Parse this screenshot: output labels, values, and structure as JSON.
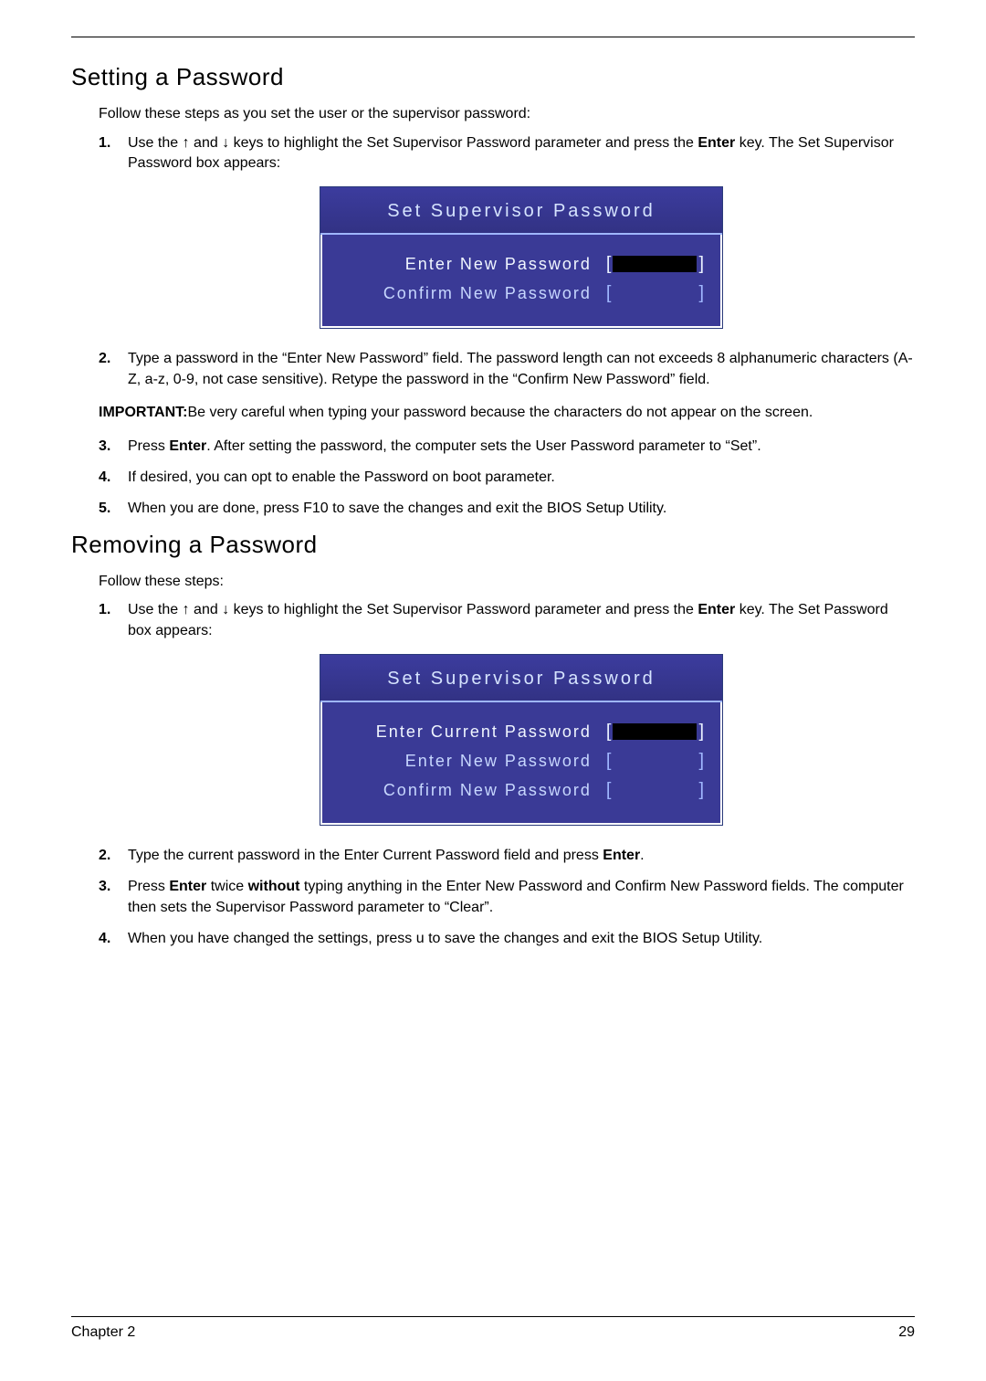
{
  "sections": {
    "setting": {
      "heading": "Setting a Password",
      "intro": "Follow these steps as you set the user or the supervisor password:",
      "steps": {
        "s1_pre": "Use the ",
        "s1_up": "↑",
        "s1_mid": " and ",
        "s1_down": "↓",
        "s1_post1": " keys to highlight the Set Supervisor Password parameter and press the ",
        "s1_enter": "Enter",
        "s1_post2": " key. The Set Supervisor Password box appears:",
        "s2": "Type a password in the “Enter New Password” field. The password length can not exceeds 8 alphanumeric characters (A-Z, a-z, 0-9, not case sensitive). Retype the password in the “Confirm New Password” field.",
        "s3_pre": "Press ",
        "s3_enter": "Enter",
        "s3_post": ". After setting the password, the computer sets the User Password parameter to “Set”.",
        "s4": "If desired, you can opt to enable the Password on boot parameter.",
        "s5": "When you are done, press F10 to save the changes and exit the BIOS Setup Utility."
      },
      "important_label": "IMPORTANT:",
      "important_text": "Be very careful when typing your password because the characters do not appear on the screen.",
      "bios": {
        "title": "Set Supervisor Password",
        "row1": "Enter New Password",
        "row2": "Confirm New Password"
      },
      "nums": {
        "n1": "1.",
        "n2": "2.",
        "n3": "3.",
        "n4": "4.",
        "n5": "5."
      }
    },
    "removing": {
      "heading": "Removing a Password",
      "intro": "Follow these steps:",
      "steps": {
        "s1_pre": "Use the ",
        "s1_up": "↑",
        "s1_mid": " and ",
        "s1_down": "↓",
        "s1_post1": " keys to highlight the Set Supervisor Password parameter and press the ",
        "s1_enter": "Enter",
        "s1_post2": " key. The Set Password box appears:",
        "s2_pre": "Type the current password in the Enter Current Password field and press ",
        "s2_enter": "Enter",
        "s2_post": ".",
        "s3_pre": "Press ",
        "s3_enter": "Enter",
        "s3_mid": " twice ",
        "s3_without": "without",
        "s3_post": " typing anything in the Enter New Password and Confirm New Password fields. The computer then sets the Supervisor Password parameter to “Clear”.",
        "s4_pre": "When you have changed the settings, press ",
        "s4_key": "u",
        "s4_post": " to save the changes and exit the BIOS Setup Utility."
      },
      "bios": {
        "title": "Set Supervisor Password",
        "row1": "Enter Current Password",
        "row2": "Enter New Password",
        "row3": "Confirm New Password"
      },
      "nums": {
        "n1": "1.",
        "n2": "2.",
        "n3": "3.",
        "n4": "4."
      }
    }
  },
  "footer": {
    "chapter": "Chapter 2",
    "page": "29"
  }
}
